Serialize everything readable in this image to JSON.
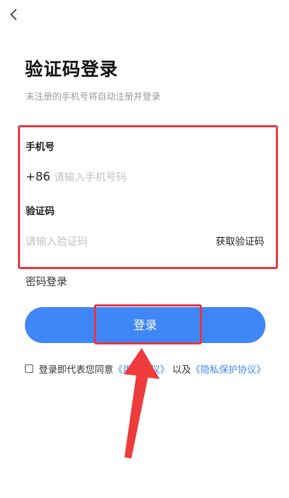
{
  "header": {
    "back_icon": "chevron-left-icon"
  },
  "page": {
    "title": "验证码登录",
    "subtitle": "未注册的手机号将自动注册并登录"
  },
  "form": {
    "phone_label": "手机号",
    "country_code": "+86",
    "phone_placeholder": "请输入手机号码",
    "code_label": "验证码",
    "code_placeholder": "请输入验证码",
    "get_code_label": "获取验证码"
  },
  "actions": {
    "password_login_label": "密码登录",
    "login_button_label": "登录"
  },
  "agreement": {
    "prefix": "登录即代表您同意",
    "user_agreement_link": "《用户协议》",
    "connector": "以及",
    "privacy_link": "《隐私保护协议》"
  },
  "colors": {
    "accent": "#3f86f7",
    "annotation": "#e8353c"
  }
}
